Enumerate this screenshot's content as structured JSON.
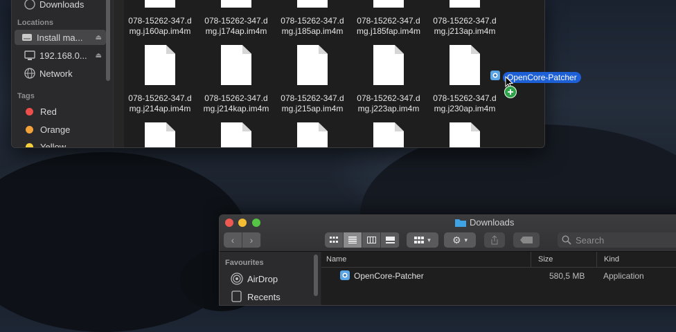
{
  "top_window": {
    "sidebar": {
      "partial_item": "Downloads",
      "locations_header": "Locations",
      "locations": [
        {
          "label": "Install ma...",
          "icon": "disk-icon",
          "eject": "⏏"
        },
        {
          "label": "192.168.0...",
          "icon": "monitor-icon",
          "eject": "⏏"
        },
        {
          "label": "Network",
          "icon": "globe-icon"
        }
      ],
      "tags_header": "Tags",
      "tags": [
        {
          "label": "Red",
          "color": "#ec4f4b"
        },
        {
          "label": "Orange",
          "color": "#f3a23a"
        },
        {
          "label": "Yellow",
          "color": "#f6cf3f"
        }
      ]
    },
    "files_row1": [
      {
        "line1": "078-15262-347.d",
        "line2": "mg.j160ap.im4m"
      },
      {
        "line1": "078-15262-347.d",
        "line2": "mg.j174ap.im4m"
      },
      {
        "line1": "078-15262-347.d",
        "line2": "mg.j185ap.im4m"
      },
      {
        "line1": "078-15262-347.d",
        "line2": "mg.j185fap.im4m"
      },
      {
        "line1": "078-15262-347.d",
        "line2": "mg.j213ap.im4m"
      }
    ],
    "files_row2": [
      {
        "line1": "078-15262-347.d",
        "line2": "mg.j214ap.im4m"
      },
      {
        "line1": "078-15262-347.d",
        "line2": "mg.j214kap.im4m"
      },
      {
        "line1": "078-15262-347.d",
        "line2": "mg.j215ap.im4m"
      },
      {
        "line1": "078-15262-347.d",
        "line2": "mg.j223ap.im4m"
      },
      {
        "line1": "078-15262-347.d",
        "line2": "mg.j230ap.im4m"
      }
    ]
  },
  "drag_item": {
    "label": "OpenCore-Patcher",
    "badge": "+"
  },
  "bottom_window": {
    "title": "Downloads",
    "search_placeholder": "Search",
    "sidebar": {
      "favourites_header": "Favourites",
      "items": [
        {
          "label": "AirDrop"
        },
        {
          "label": "Recents"
        }
      ]
    },
    "columns": {
      "name": "Name",
      "size": "Size",
      "kind": "Kind"
    },
    "rows": [
      {
        "name": "OpenCore-Patcher",
        "size": "580,5 MB",
        "kind": "Application"
      }
    ]
  }
}
